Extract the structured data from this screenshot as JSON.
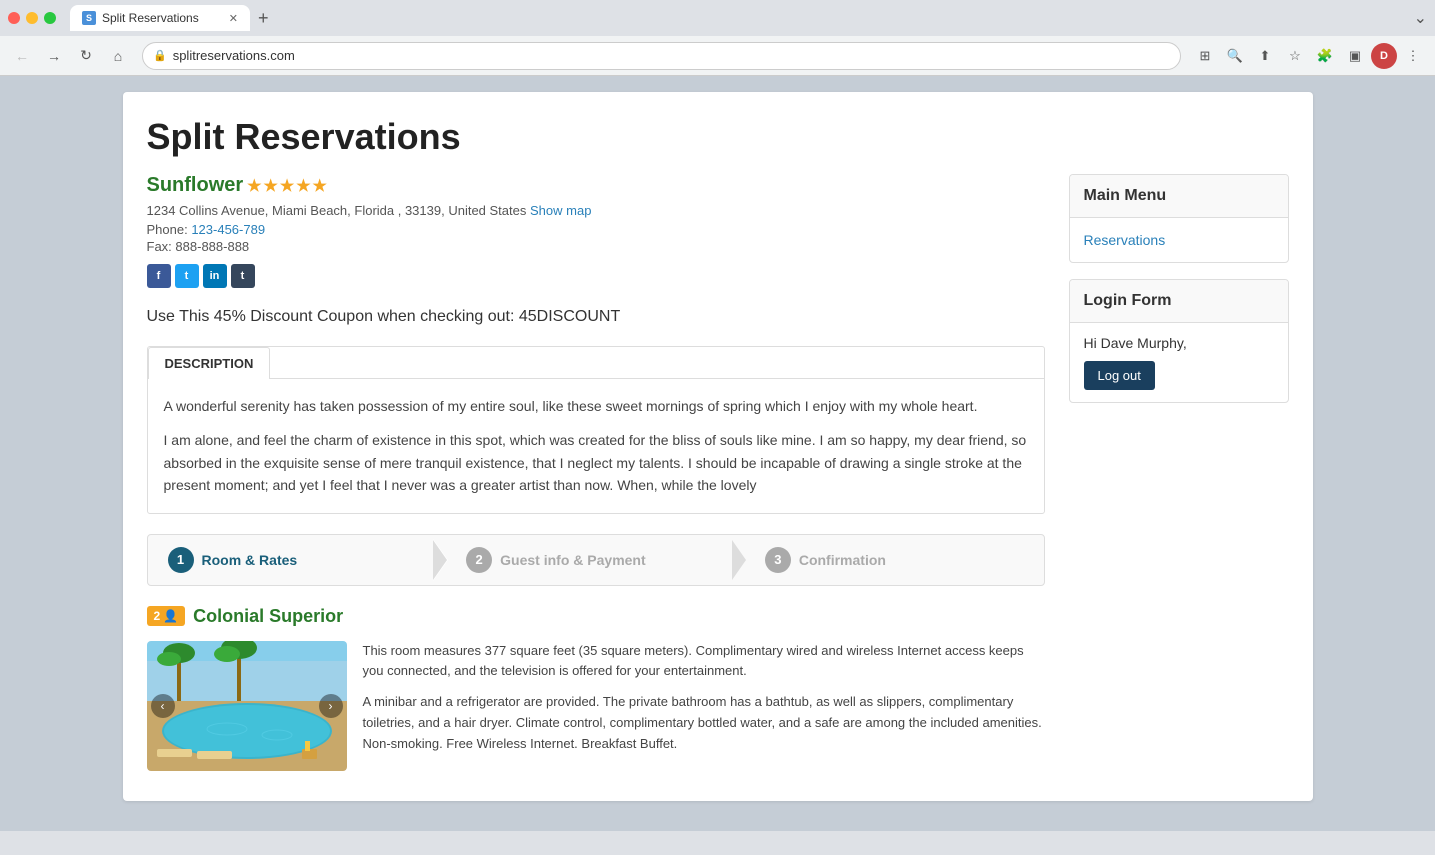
{
  "browser": {
    "tab_label": "Split Reservations",
    "tab_favicon": "S",
    "address": "splitreservations.com",
    "new_tab_icon": "+",
    "menu_icon": "⌄"
  },
  "page": {
    "title": "Split Reservations",
    "hotel_name": "Sunflower",
    "stars_count": 5,
    "address": "1234 Collins Avenue, Miami Beach, Florida , 33139, United States",
    "show_map_label": "Show map",
    "phone_label": "Phone:",
    "phone": "123-456-789",
    "fax_label": "Fax:",
    "fax": "888-888-888",
    "discount_text": "Use This 45% Discount Coupon when checking out: 45DISCOUNT",
    "description_tab_label": "DESCRIPTION",
    "description_p1": "A wonderful serenity has taken possession of my entire soul, like these sweet mornings of spring which I enjoy with my whole heart.",
    "description_p2": "I am alone, and feel the charm of existence in this spot, which was created for the bliss of souls like mine. I am so happy, my dear friend, so absorbed in the exquisite sense of mere tranquil existence, that I neglect my talents. I should be incapable of drawing a single stroke at the present moment; and yet I feel that I never was a greater artist than now. When, while the lovely",
    "steps": [
      {
        "num": "1",
        "label": "Room & Rates",
        "active": true
      },
      {
        "num": "2",
        "label": "Guest info & Payment",
        "active": false
      },
      {
        "num": "3",
        "label": "Confirmation",
        "active": false
      }
    ],
    "room_badge": "2",
    "room_badge_icon": "👤",
    "room_name": "Colonial Superior",
    "room_desc_p1": "This room measures 377 square feet (35 square meters). Complimentary wired and wireless Internet access keeps you connected, and the television is offered for your entertainment.",
    "room_desc_p2": "A minibar and a refrigerator are provided. The private bathroom has a bathtub, as well as slippers, complimentary toiletries, and a hair dryer. Climate control, complimentary bottled water, and a safe are among the included amenities. Non-smoking. Free Wireless Internet. Breakfast Buffet.",
    "social": {
      "facebook": "f",
      "twitter": "t",
      "linkedin": "in",
      "tumblr": "t"
    }
  },
  "sidebar": {
    "main_menu_title": "Main Menu",
    "reservations_link": "Reservations",
    "login_form_title": "Login Form",
    "greeting": "Hi Dave Murphy,",
    "logout_label": "Log out"
  }
}
